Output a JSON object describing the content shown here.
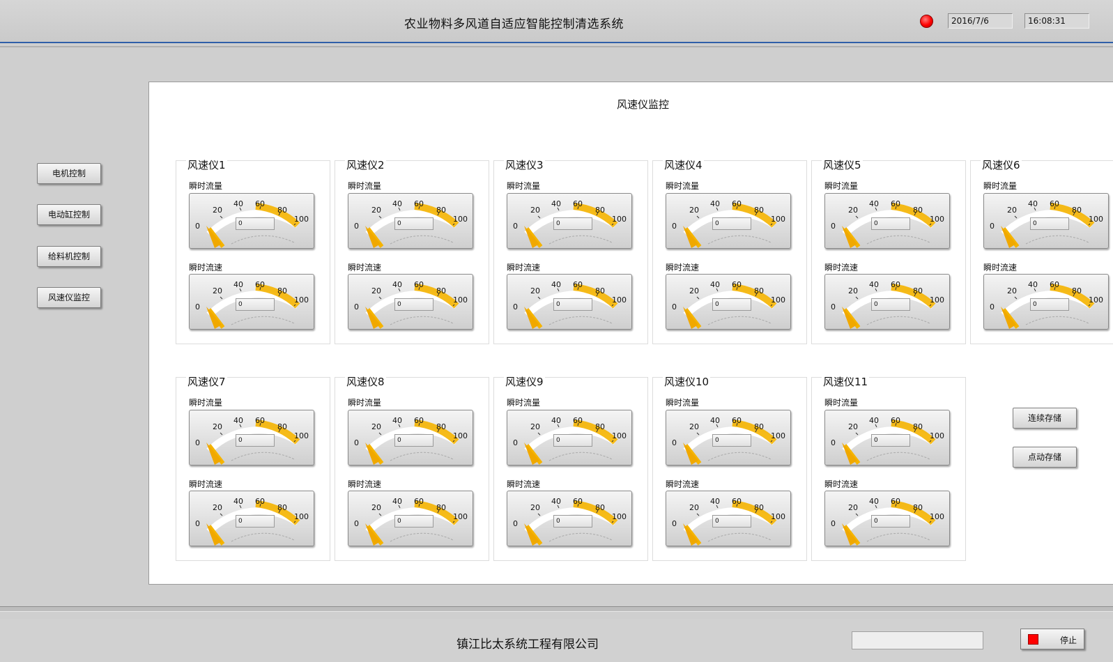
{
  "header": {
    "title": "农业物料多风道自适应智能控制清选系统",
    "status_led_color": "#ff0000",
    "date": "2016/7/6",
    "time": "16:08:31"
  },
  "nav": [
    {
      "label": "电机控制"
    },
    {
      "label": "电动缸控制"
    },
    {
      "label": "给料机控制"
    },
    {
      "label": "风速仪监控"
    }
  ],
  "panel": {
    "title": "风速仪监控"
  },
  "gauge_scale": {
    "min": 0,
    "max": 100,
    "ticks": [
      "0",
      "20",
      "40",
      "60",
      "80",
      "100"
    ],
    "accent": "#f5b400"
  },
  "anemometers": [
    {
      "name": "风速仪1",
      "flow_label": "瞬时流量",
      "flow_value": "0",
      "speed_label": "瞬时流速",
      "speed_value": "0"
    },
    {
      "name": "风速仪2",
      "flow_label": "瞬时流量",
      "flow_value": "0",
      "speed_label": "瞬时流速",
      "speed_value": "0"
    },
    {
      "name": "风速仪3",
      "flow_label": "瞬时流量",
      "flow_value": "0",
      "speed_label": "瞬时流速",
      "speed_value": "0"
    },
    {
      "name": "风速仪4",
      "flow_label": "瞬时流量",
      "flow_value": "0",
      "speed_label": "瞬时流速",
      "speed_value": "0"
    },
    {
      "name": "风速仪5",
      "flow_label": "瞬时流量",
      "flow_value": "0",
      "speed_label": "瞬时流速",
      "speed_value": "0"
    },
    {
      "name": "风速仪6",
      "flow_label": "瞬时流量",
      "flow_value": "0",
      "speed_label": "瞬时流速",
      "speed_value": "0"
    },
    {
      "name": "风速仪7",
      "flow_label": "瞬时流量",
      "flow_value": "0",
      "speed_label": "瞬时流速",
      "speed_value": "0"
    },
    {
      "name": "风速仪8",
      "flow_label": "瞬时流量",
      "flow_value": "0",
      "speed_label": "瞬时流速",
      "speed_value": "0"
    },
    {
      "name": "风速仪9",
      "flow_label": "瞬时流量",
      "flow_value": "0",
      "speed_label": "瞬时流速",
      "speed_value": "0"
    },
    {
      "name": "风速仪10",
      "flow_label": "瞬时流量",
      "flow_value": "0",
      "speed_label": "瞬时流速",
      "speed_value": "0"
    },
    {
      "name": "风速仪11",
      "flow_label": "瞬时流量",
      "flow_value": "0",
      "speed_label": "瞬时流速",
      "speed_value": "0"
    }
  ],
  "actions": {
    "continuous_save": "连续存储",
    "single_save": "点动存储"
  },
  "footer": {
    "company": "镇江比太系统工程有限公司",
    "status_text": "",
    "stop_label": "停止",
    "stop_color": "#ff0000"
  }
}
